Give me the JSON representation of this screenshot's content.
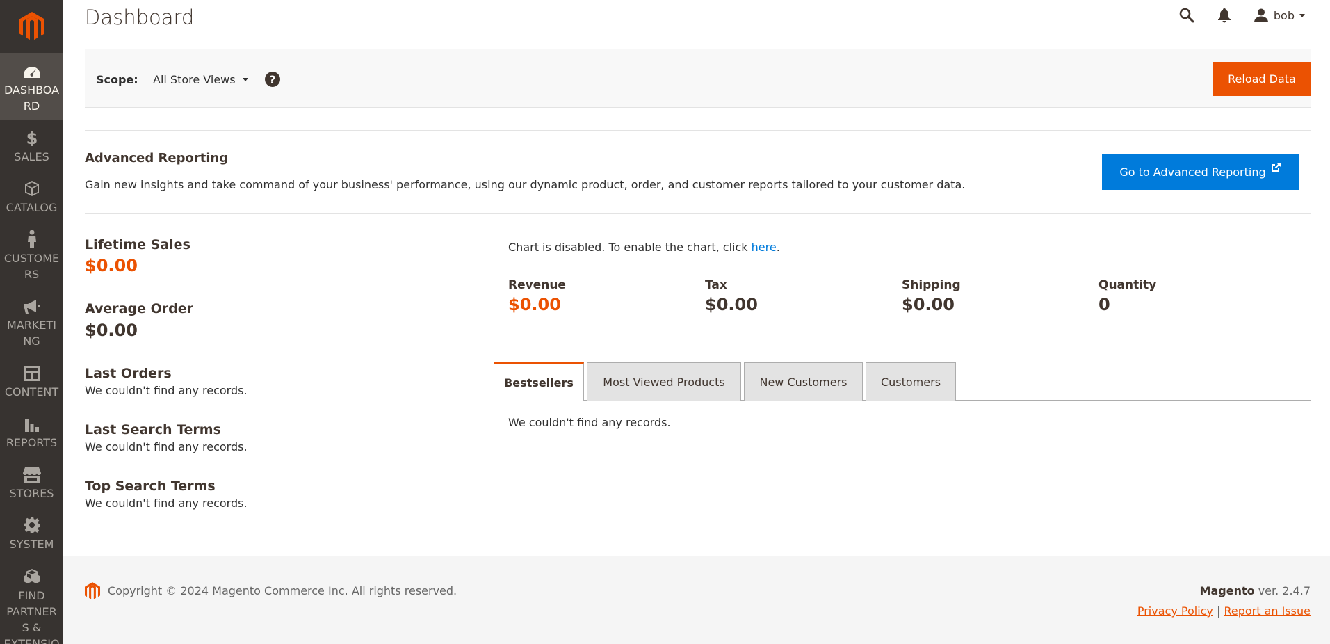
{
  "page": {
    "title": "Dashboard"
  },
  "header": {
    "user_name": "bob"
  },
  "sidebar": {
    "items": [
      {
        "label": "DASHBOA RD",
        "icon": "dashboard-icon",
        "active": true
      },
      {
        "label": "SALES",
        "icon": "dollar-icon"
      },
      {
        "label": "CATALOG",
        "icon": "box-icon"
      },
      {
        "label": "CUSTOME RS",
        "icon": "person-icon"
      },
      {
        "label": "MARKETI NG",
        "icon": "megaphone-icon"
      },
      {
        "label": "CONTENT",
        "icon": "layout-icon"
      },
      {
        "label": "REPORTS",
        "icon": "bar-chart-icon"
      },
      {
        "label": "STORES",
        "icon": "storefront-icon"
      },
      {
        "label": "SYSTEM",
        "icon": "gear-icon"
      },
      {
        "label": "FIND PARTNER S & EXTENSIO NS",
        "icon": "cubes-icon"
      }
    ]
  },
  "scope": {
    "label": "Scope:",
    "value": "All Store Views",
    "reload_label": "Reload Data"
  },
  "advanced_reporting": {
    "title": "Advanced Reporting",
    "description": "Gain new insights and take command of your business' performance, using our dynamic product, order, and customer reports tailored to your customer data.",
    "button_label": "Go to Advanced Reporting"
  },
  "stats": {
    "lifetime_sales_label": "Lifetime Sales",
    "lifetime_sales_value": "$0.00",
    "average_order_label": "Average Order",
    "average_order_value": "$0.00"
  },
  "sections": {
    "last_orders": {
      "title": "Last Orders",
      "empty": "We couldn't find any records."
    },
    "last_search_terms": {
      "title": "Last Search Terms",
      "empty": "We couldn't find any records."
    },
    "top_search_terms": {
      "title": "Top Search Terms",
      "empty": "We couldn't find any records."
    }
  },
  "chart": {
    "message_prefix": "Chart is disabled. To enable the chart, click ",
    "message_link": "here",
    "message_suffix": "."
  },
  "totals": {
    "revenue_label": "Revenue",
    "revenue_value": "$0.00",
    "tax_label": "Tax",
    "tax_value": "$0.00",
    "shipping_label": "Shipping",
    "shipping_value": "$0.00",
    "quantity_label": "Quantity",
    "quantity_value": "0"
  },
  "tabs": {
    "items": [
      "Bestsellers",
      "Most Viewed Products",
      "New Customers",
      "Customers"
    ],
    "empty": "We couldn't find any records."
  },
  "footer": {
    "copyright": "Copyright © 2024 Magento Commerce Inc. All rights reserved.",
    "brand": "Magento",
    "version": " ver. 2.4.7",
    "privacy_label": "Privacy Policy",
    "separator": " | ",
    "report_label": "Report an Issue"
  },
  "colors": {
    "accent": "#eb5202",
    "link": "#007bdb",
    "sidebar_bg": "#373330"
  }
}
